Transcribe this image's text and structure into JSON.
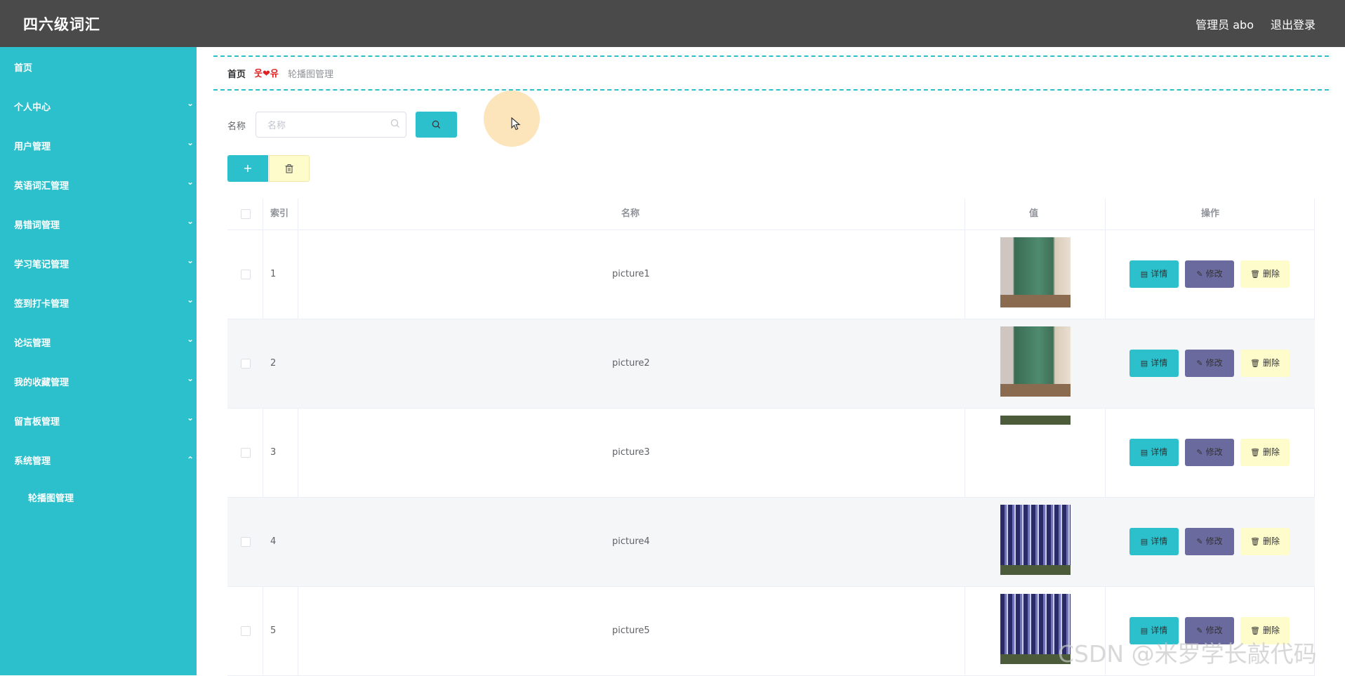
{
  "app": {
    "title": "四六级词汇"
  },
  "header": {
    "user_label": "管理员 abo",
    "logout_label": "退出登录"
  },
  "sidebar": {
    "items": [
      {
        "label": "首页",
        "has_chevron": false
      },
      {
        "label": "个人中心",
        "has_chevron": true
      },
      {
        "label": "用户管理",
        "has_chevron": true
      },
      {
        "label": "英语词汇管理",
        "has_chevron": true
      },
      {
        "label": "易错词管理",
        "has_chevron": true
      },
      {
        "label": "学习笔记管理",
        "has_chevron": true
      },
      {
        "label": "签到打卡管理",
        "has_chevron": true
      },
      {
        "label": "论坛管理",
        "has_chevron": true
      },
      {
        "label": "我的收藏管理",
        "has_chevron": true
      },
      {
        "label": "留言板管理",
        "has_chevron": true
      },
      {
        "label": "系统管理",
        "has_chevron": true,
        "expanded": true
      }
    ],
    "sub_items": [
      {
        "label": "轮播图管理"
      }
    ]
  },
  "breadcrumb": {
    "home": "首页",
    "separator": "웃❤유",
    "current": "轮播图管理"
  },
  "search": {
    "label": "名称",
    "placeholder": "名称",
    "value": ""
  },
  "toolbar": {
    "add_icon": "plus-icon",
    "delete_icon": "trash-icon"
  },
  "table": {
    "columns": {
      "index": "索引",
      "name": "名称",
      "value": "值",
      "actions": "操作"
    },
    "action_labels": {
      "detail": "详情",
      "edit": "修改",
      "delete": "删除"
    },
    "rows": [
      {
        "index": "1",
        "name": "picture1",
        "image": "classroom"
      },
      {
        "index": "2",
        "name": "picture2",
        "image": "classroom"
      },
      {
        "index": "3",
        "name": "picture3",
        "image": "building-strip"
      },
      {
        "index": "4",
        "name": "picture4",
        "image": "building"
      },
      {
        "index": "5",
        "name": "picture5",
        "image": "building"
      }
    ]
  },
  "colors": {
    "accent": "#2bc0cc",
    "edit": "#6b6a9f",
    "delete": "#fffccb",
    "header_bg": "#4a4a4a"
  },
  "watermark": "CSDN @米罗学长敲代码"
}
